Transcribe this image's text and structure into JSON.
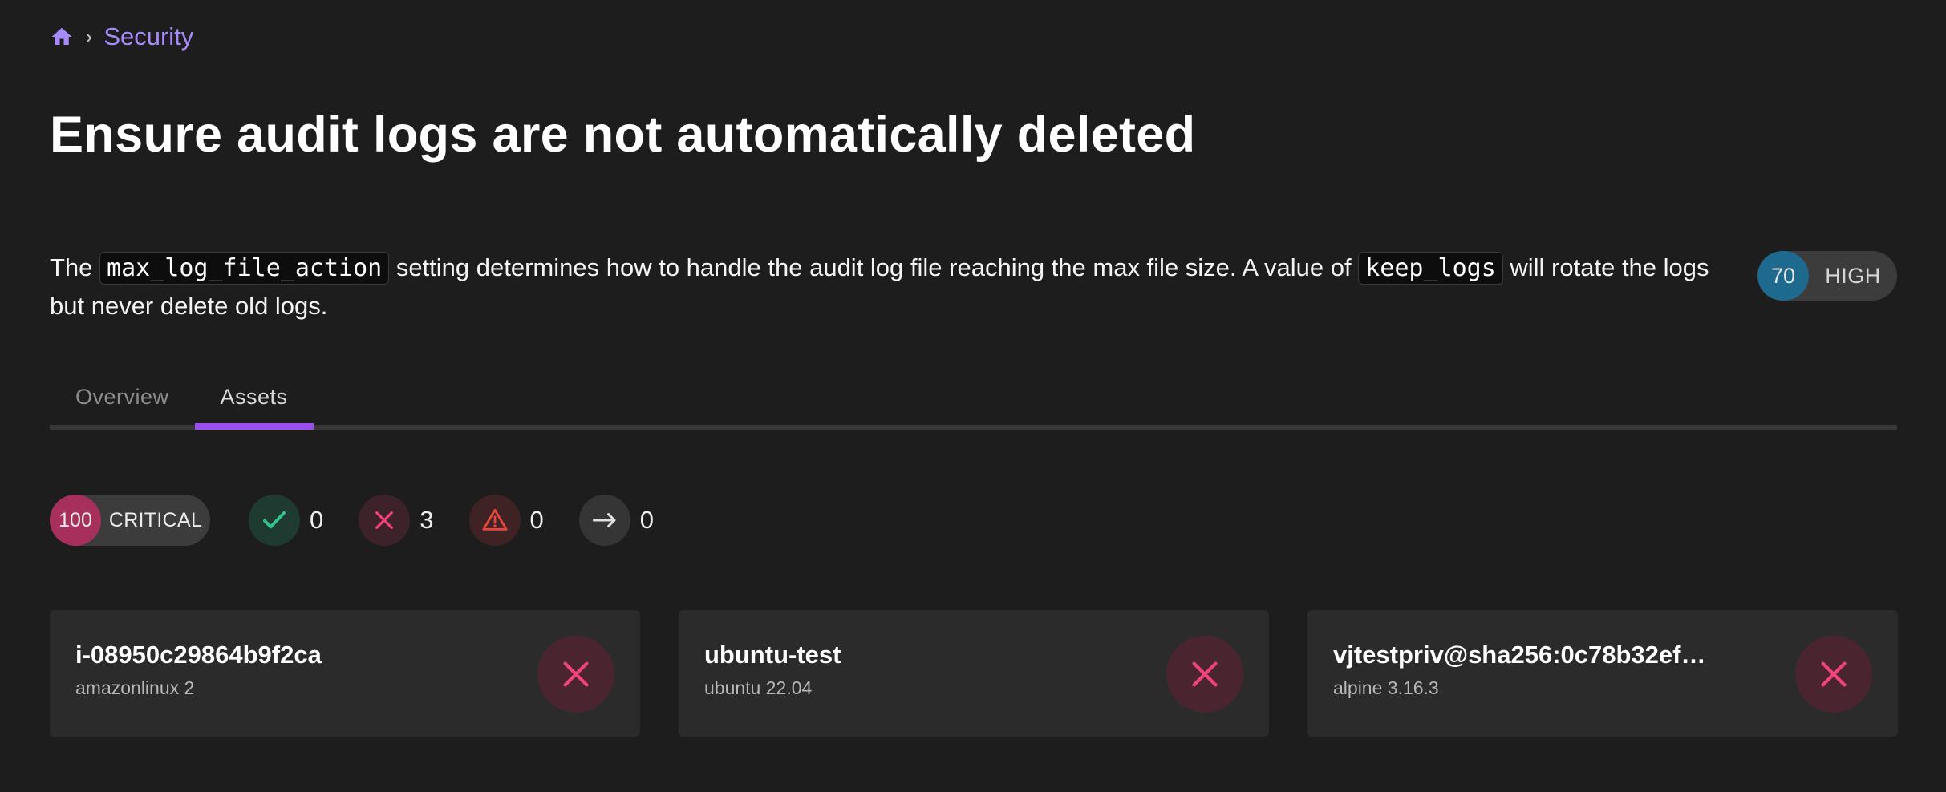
{
  "breadcrumb": {
    "home_icon": "home-icon",
    "separator": "›",
    "current": "Security"
  },
  "page_title": "Ensure audit logs are not automatically deleted",
  "description": {
    "part1": "The ",
    "code1": "max_log_file_action",
    "part2": " setting determines how to handle the audit log file reaching the max file size. A value of ",
    "code2": "keep_logs",
    "part3": " will rotate the logs but never delete old logs."
  },
  "score": {
    "value": "70",
    "label": "HIGH",
    "color": "#1e6a8e"
  },
  "tabs": [
    {
      "label": "Overview",
      "active": false
    },
    {
      "label": "Assets",
      "active": true
    }
  ],
  "stats": {
    "risk": {
      "value": "100",
      "label": "CRITICAL",
      "color": "#a6305b"
    },
    "passed": {
      "icon": "check-icon",
      "count": "0",
      "color": "#34c48b"
    },
    "failed": {
      "icon": "x-icon",
      "count": "3",
      "color": "#f0437a"
    },
    "errors": {
      "icon": "warning-icon",
      "count": "0",
      "color": "#e8453c"
    },
    "skipped": {
      "icon": "arrow-right-icon",
      "count": "0",
      "color": "#e0e0e0"
    }
  },
  "assets": [
    {
      "name": "i-08950c29864b9f2ca",
      "os": "amazonlinux 2",
      "status": "failed",
      "status_icon": "x-icon"
    },
    {
      "name": "ubuntu-test",
      "os": "ubuntu 22.04",
      "status": "failed",
      "status_icon": "x-icon"
    },
    {
      "name": "vjtestpriv@sha256:0c78b32ef…",
      "os": "alpine 3.16.3",
      "status": "failed",
      "status_icon": "x-icon"
    }
  ]
}
